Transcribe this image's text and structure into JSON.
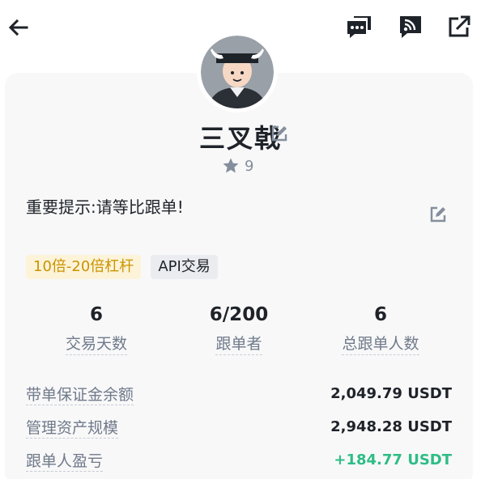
{
  "header": {
    "back_icon": "arrow-left-icon",
    "chat_icon": "chat-bubble-icon",
    "feed_icon": "rss-feed-icon",
    "share_icon": "share-external-icon"
  },
  "profile": {
    "avatar_icon": "bull-avatar-icon",
    "name": "三叉戟",
    "rating": "9",
    "notice": "重要提示:请等比跟单!"
  },
  "tags": [
    {
      "label": "10倍-20倍杠杆"
    },
    {
      "label": "API交易"
    }
  ],
  "stats": [
    {
      "value": "6",
      "label": "交易天数"
    },
    {
      "value": "6/200",
      "label": "跟单者"
    },
    {
      "value": "6",
      "label": "总跟单人数"
    }
  ],
  "details": [
    {
      "label": "带单保证金余额",
      "value": "2,049.79 USDT"
    },
    {
      "label": "管理资产规模",
      "value": "2,948.28 USDT"
    },
    {
      "label": "跟单人盈亏",
      "value": "+184.77 USDT"
    }
  ],
  "colors": {
    "positive": "#2ebd85",
    "tag_gold": "#c99400",
    "tag_gold_bg": "#fdf3d9"
  }
}
